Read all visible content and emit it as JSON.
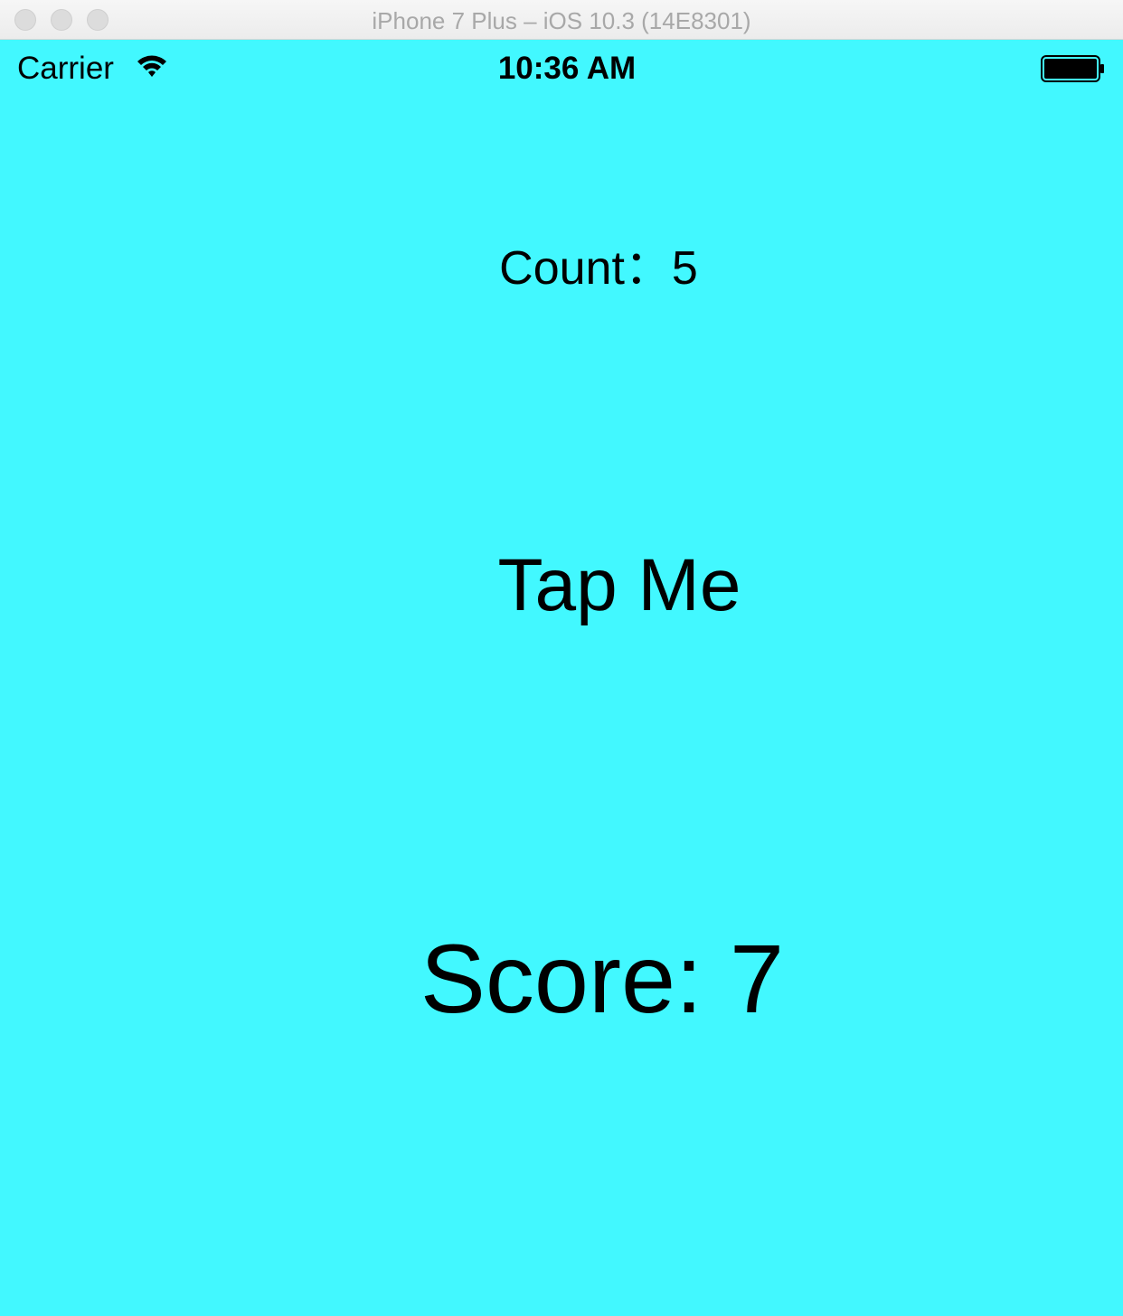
{
  "window": {
    "title": "iPhone 7 Plus – iOS 10.3 (14E8301)"
  },
  "status_bar": {
    "carrier": "Carrier",
    "time": "10:36 AM",
    "wifi_icon": "wifi-icon",
    "battery_icon": "battery-full-icon",
    "battery_level": 1.0
  },
  "screen": {
    "background_color": "#42f8ff",
    "count_label": "Count：5",
    "tap_button_label": "Tap Me",
    "score_label": "Score: 7"
  }
}
